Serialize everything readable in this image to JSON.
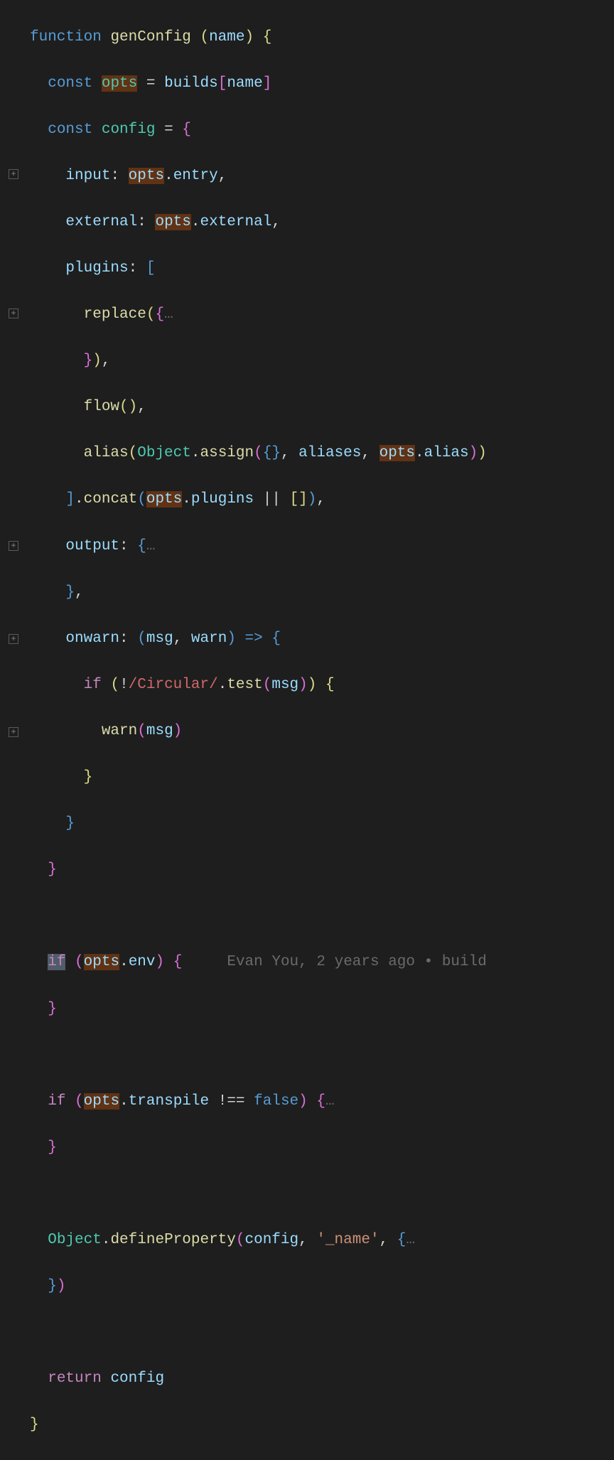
{
  "gutter": {
    "fold_icons_positions": [
      "line-8",
      "line-14",
      "line-24",
      "line-28",
      "line-31"
    ],
    "fold_glyph": "+"
  },
  "blame": {
    "author": "Evan You",
    "age": "2 years ago",
    "message": "build"
  },
  "code": {
    "l1": {
      "function": "function",
      "name": "genConfig",
      "param": "name"
    },
    "l2": {
      "const": "const",
      "var": "opts",
      "eq": "=",
      "rhs_ident": "builds",
      "subscript": "name"
    },
    "l3": {
      "const": "const",
      "var": "config",
      "eq": "="
    },
    "l4": {
      "key": "input",
      "obj": "opts",
      "prop": "entry"
    },
    "l5": {
      "key": "external",
      "obj": "opts",
      "prop": "external"
    },
    "l6": {
      "key": "plugins"
    },
    "l7": {
      "call": "replace",
      "ellipsis": "…"
    },
    "l8": {},
    "l9": {
      "call": "flow"
    },
    "l10": {
      "call": "alias",
      "obj": "Object",
      "method": "assign",
      "arg1": "aliases",
      "opts": "opts",
      "prop": "alias"
    },
    "l11": {
      "method": "concat",
      "obj": "opts",
      "prop": "plugins"
    },
    "l12": {
      "key": "output",
      "ellipsis": "…"
    },
    "l13": {},
    "l14": {
      "key": "onwarn",
      "p1": "msg",
      "p2": "warn"
    },
    "l15": {
      "if": "if",
      "regex": "/Circular/",
      "method": "test",
      "arg": "msg"
    },
    "l16": {
      "call": "warn",
      "arg": "msg"
    },
    "l24": {
      "if": "if",
      "obj": "opts",
      "prop": "env"
    },
    "l28": {
      "if": "if",
      "obj": "opts",
      "prop": "transpile",
      "bool": "false",
      "ellipsis": "…"
    },
    "l31": {
      "obj": "Object",
      "method": "defineProperty",
      "arg1": "config",
      "str": "'_name'",
      "ellipsis": "…"
    },
    "l34": {
      "return": "return",
      "ident": "config"
    }
  }
}
